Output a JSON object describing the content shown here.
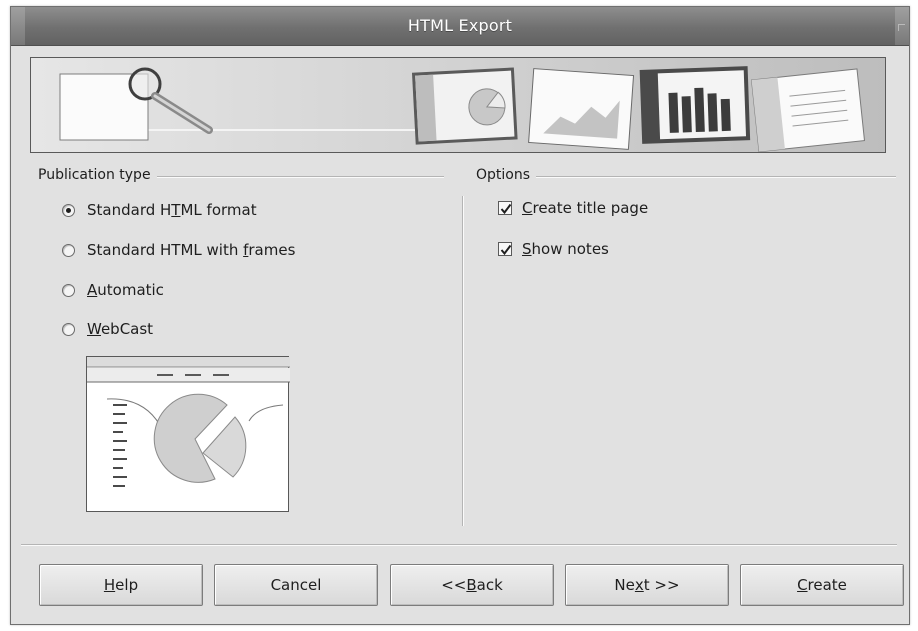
{
  "window": {
    "title": "HTML Export"
  },
  "publication_type": {
    "heading": "Publication type",
    "selected": "Standard HTML format",
    "options": [
      {
        "pre": "Standard H",
        "key": "T",
        "post": "ML format",
        "checked": true
      },
      {
        "pre": "Standard HTML with ",
        "key": "f",
        "post": "rames",
        "checked": false
      },
      {
        "pre": "",
        "key": "A",
        "post": "utomatic",
        "checked": false
      },
      {
        "pre": "",
        "key": "W",
        "post": "ebCast",
        "checked": false
      }
    ]
  },
  "options": {
    "heading": "Options",
    "items": [
      {
        "pre": "",
        "key": "C",
        "post": "reate title page",
        "checked": true
      },
      {
        "pre": "",
        "key": "S",
        "post": "how notes",
        "checked": true
      }
    ]
  },
  "buttons": [
    {
      "pre": "",
      "key": "H",
      "post": "elp"
    },
    {
      "pre": "Cancel",
      "key": "",
      "post": ""
    },
    {
      "pre": "<< ",
      "key": "B",
      "post": "ack"
    },
    {
      "pre": "Ne",
      "key": "x",
      "post": "t >>"
    },
    {
      "pre": "",
      "key": "C",
      "post": "reate"
    }
  ],
  "icons": {
    "banner": "html-export-banner-illustration",
    "preview": "pie-chart-page-preview",
    "checkmark": "checkmark-icon"
  }
}
